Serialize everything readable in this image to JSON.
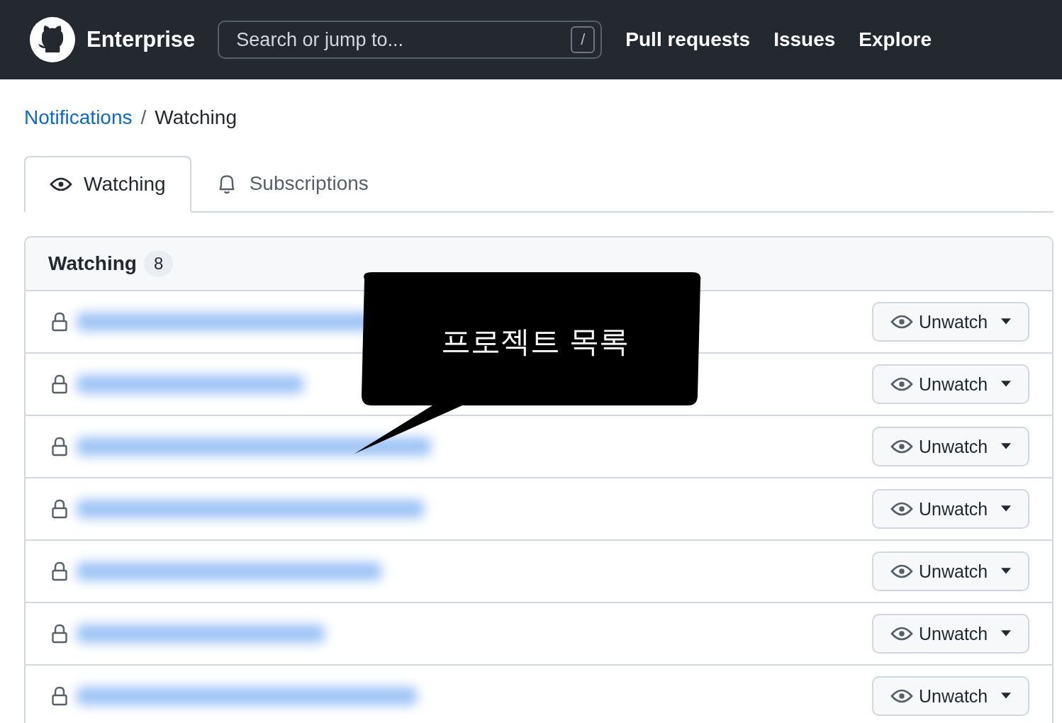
{
  "header": {
    "brand": "Enterprise",
    "search": {
      "placeholder": "Search or jump to...",
      "shortcut": "/"
    },
    "nav": [
      "Pull requests",
      "Issues",
      "Explore"
    ]
  },
  "breadcrumb": {
    "link": "Notifications",
    "separator": "/",
    "current": "Watching"
  },
  "tabs": [
    {
      "label": "Watching",
      "kind": "eye",
      "selected": true
    },
    {
      "label": "Subscriptions",
      "kind": "bell",
      "selected": false
    }
  ],
  "list": {
    "title": "Watching",
    "count": "8",
    "rows": [
      {
        "private": true,
        "button": "Unwatch"
      },
      {
        "private": true,
        "button": "Unwatch"
      },
      {
        "private": true,
        "button": "Unwatch"
      },
      {
        "private": true,
        "button": "Unwatch"
      },
      {
        "private": true,
        "button": "Unwatch"
      },
      {
        "private": true,
        "button": "Unwatch"
      },
      {
        "private": true,
        "button": "Unwatch"
      }
    ]
  },
  "callout": {
    "text": "프로젝트 목록"
  }
}
